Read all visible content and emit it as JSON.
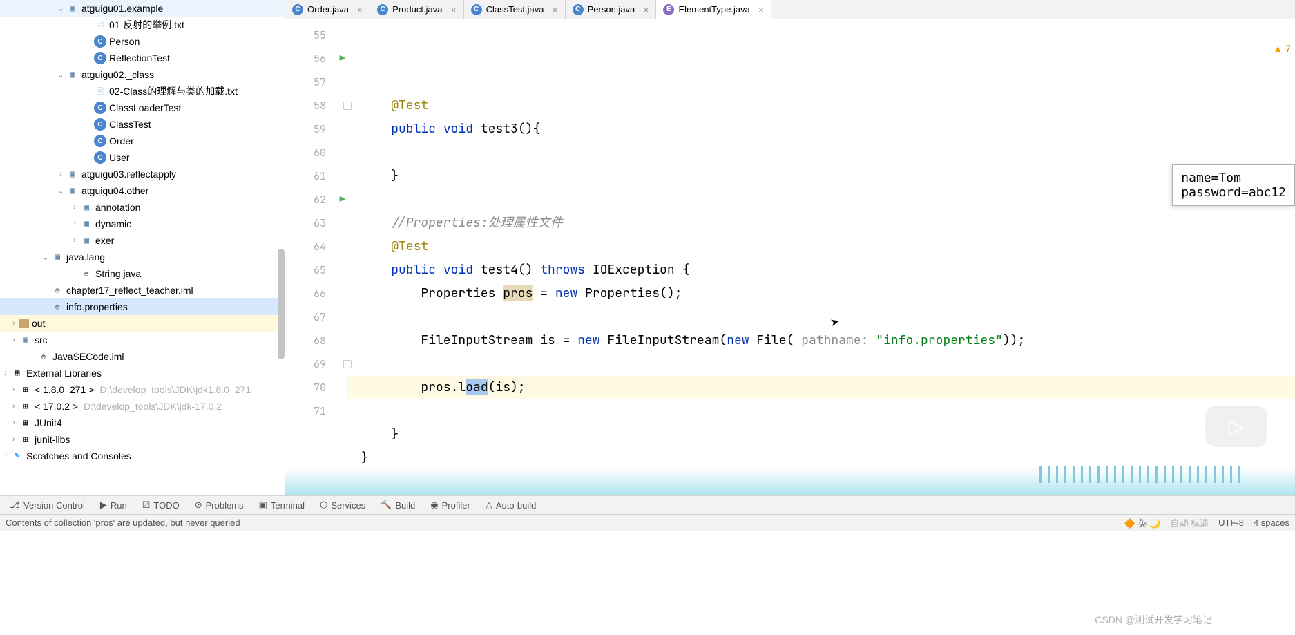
{
  "tree": {
    "items": [
      {
        "indent": 80,
        "arrow": "down",
        "icon": "folder",
        "label": "atguigu01.example"
      },
      {
        "indent": 120,
        "arrow": "",
        "icon": "file",
        "label": "01-反射的举例.txt"
      },
      {
        "indent": 120,
        "arrow": "",
        "icon": "class",
        "label": "Person"
      },
      {
        "indent": 120,
        "arrow": "",
        "icon": "class",
        "label": "ReflectionTest"
      },
      {
        "indent": 80,
        "arrow": "down",
        "icon": "folder",
        "label": "atguigu02._class"
      },
      {
        "indent": 120,
        "arrow": "",
        "icon": "file",
        "label": "02-Class的理解与类的加载.txt"
      },
      {
        "indent": 120,
        "arrow": "",
        "icon": "class",
        "label": "ClassLoaderTest"
      },
      {
        "indent": 120,
        "arrow": "",
        "icon": "class",
        "label": "ClassTest"
      },
      {
        "indent": 120,
        "arrow": "",
        "icon": "class",
        "label": "Order"
      },
      {
        "indent": 120,
        "arrow": "",
        "icon": "class",
        "label": "User"
      },
      {
        "indent": 80,
        "arrow": "right",
        "icon": "folder",
        "label": "atguigu03.reflectapply"
      },
      {
        "indent": 80,
        "arrow": "down",
        "icon": "folder",
        "label": "atguigu04.other"
      },
      {
        "indent": 100,
        "arrow": "right",
        "icon": "folder",
        "label": "annotation"
      },
      {
        "indent": 100,
        "arrow": "right",
        "icon": "folder",
        "label": "dynamic"
      },
      {
        "indent": 100,
        "arrow": "right",
        "icon": "folder",
        "label": "exer"
      },
      {
        "indent": 58,
        "arrow": "down",
        "icon": "folder",
        "label": "java.lang"
      },
      {
        "indent": 100,
        "arrow": "",
        "icon": "iml",
        "label": "String.java"
      },
      {
        "indent": 58,
        "arrow": "",
        "icon": "iml",
        "label": "chapter17_reflect_teacher.iml"
      },
      {
        "indent": 58,
        "arrow": "",
        "icon": "iml",
        "label": "info.properties",
        "sel": true
      },
      {
        "indent": 12,
        "arrow": "right",
        "icon": "folder-tan",
        "label": "out",
        "hl": true
      },
      {
        "indent": 12,
        "arrow": "right",
        "icon": "folder",
        "label": "src"
      },
      {
        "indent": 38,
        "arrow": "",
        "icon": "iml",
        "label": "JavaSECode.iml"
      },
      {
        "indent": 0,
        "arrow": "right",
        "icon": "lib",
        "label": "External Libraries"
      },
      {
        "indent": 12,
        "arrow": "right",
        "icon": "lib",
        "label": "< 1.8.0_271 >",
        "hint": "D:\\develop_tools\\JDK\\jdk1.8.0_271"
      },
      {
        "indent": 12,
        "arrow": "right",
        "icon": "lib",
        "label": "< 17.0.2 >",
        "hint": "D:\\develop_tools\\JDK\\jdk-17.0.2"
      },
      {
        "indent": 12,
        "arrow": "right",
        "icon": "lib",
        "label": "JUnit4"
      },
      {
        "indent": 12,
        "arrow": "right",
        "icon": "lib",
        "label": "junit-libs"
      },
      {
        "indent": 0,
        "arrow": "right",
        "icon": "scratch",
        "label": "Scratches and Consoles"
      }
    ]
  },
  "tabs": [
    {
      "icon": "cls",
      "label": "Order.java",
      "active": false
    },
    {
      "icon": "cls",
      "label": "Product.java",
      "active": false
    },
    {
      "icon": "cls",
      "label": "ClassTest.java",
      "active": false
    },
    {
      "icon": "cls",
      "label": "Person.java",
      "active": false
    },
    {
      "icon": "enm",
      "label": "ElementType.java",
      "active": true
    }
  ],
  "gutter_start": 55,
  "code_lines": [
    {
      "n": 55,
      "html": "    <span class='k-annotation'>@Test</span>"
    },
    {
      "n": 56,
      "run": true,
      "html": "    <span class='k-keyword'>public</span> <span class='k-keyword'>void</span> <span class='k-method'>test3</span>(){"
    },
    {
      "n": 57,
      "html": ""
    },
    {
      "n": 58,
      "fold": true,
      "html": "    }"
    },
    {
      "n": 59,
      "html": ""
    },
    {
      "n": 60,
      "html": "    <span class='k-comment'>//Properties:处理属性文件</span>"
    },
    {
      "n": 61,
      "html": "    <span class='k-annotation'>@Test</span>"
    },
    {
      "n": 62,
      "run": true,
      "html": "    <span class='k-keyword'>public</span> <span class='k-keyword'>void</span> <span class='k-method'>test4</span>() <span class='k-keyword'>throws</span> IOException {"
    },
    {
      "n": 63,
      "html": "        Properties <span class='k-highlight'>pros</span> = <span class='k-keyword'>new</span> Properties();"
    },
    {
      "n": 64,
      "html": ""
    },
    {
      "n": 65,
      "html": "        FileInputStream is = <span class='k-keyword'>new</span> FileInputStream(<span class='k-keyword'>new</span> File( <span class='k-param'>pathname:</span> <span class='k-string'>\"info.properties\"</span>));"
    },
    {
      "n": 66,
      "html": ""
    },
    {
      "n": 67,
      "current": true,
      "html": "        pros.l<span class='selection-box'>oad</span>(is);"
    },
    {
      "n": 68,
      "html": ""
    },
    {
      "n": 69,
      "fold": true,
      "html": "    }"
    },
    {
      "n": 70,
      "html": "}"
    },
    {
      "n": 71,
      "html": ""
    }
  ],
  "warning_count": "7",
  "popup": {
    "line1": "name=Tom",
    "line2": "password=abc12"
  },
  "bottom_tools": [
    {
      "icon": "⎇",
      "label": "Version Control"
    },
    {
      "icon": "▶",
      "label": "Run"
    },
    {
      "icon": "☑",
      "label": "TODO"
    },
    {
      "icon": "⊘",
      "label": "Problems"
    },
    {
      "icon": "▣",
      "label": "Terminal"
    },
    {
      "icon": "⬡",
      "label": "Services"
    },
    {
      "icon": "🔨",
      "label": "Build"
    },
    {
      "icon": "◉",
      "label": "Profiler"
    },
    {
      "icon": "△",
      "label": "Auto-build"
    }
  ],
  "status_left": "Contents of collection 'pros' are updated, but never queried",
  "status_right": {
    "lang": "英",
    "enc": "UTF-8",
    "spaces": "4 spaces",
    "misc": "自动     标清"
  },
  "watermark": "CSDN @测试开发学习笔记"
}
